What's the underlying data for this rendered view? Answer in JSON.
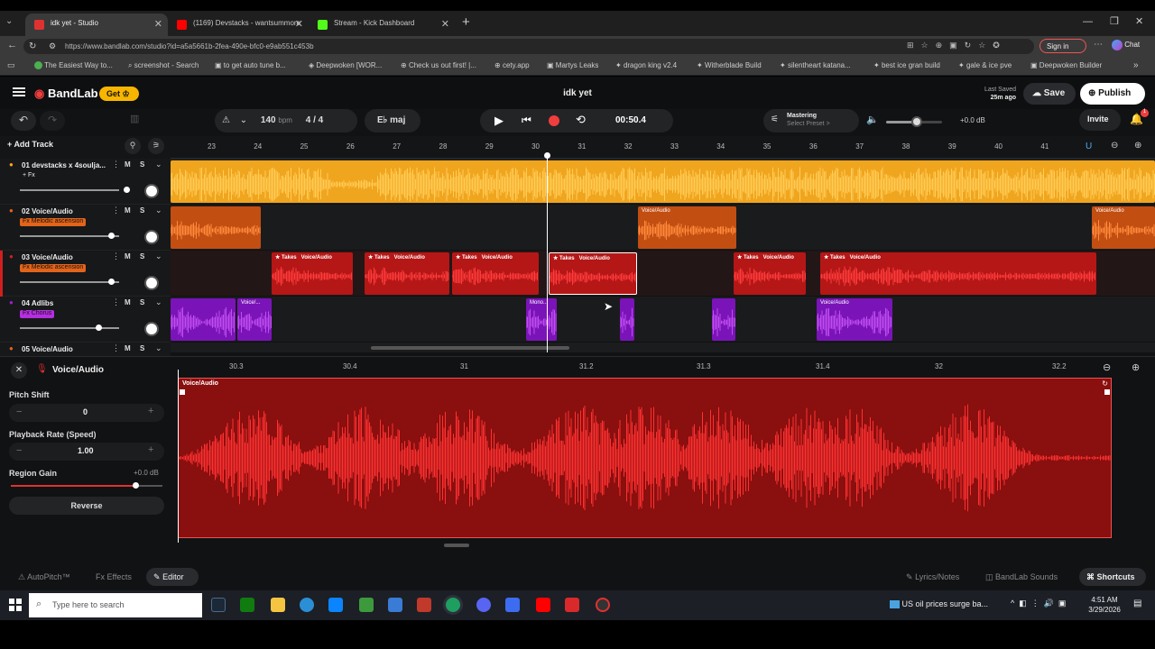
{
  "browser": {
    "tabs": [
      {
        "label": "idk yet - Studio",
        "active": true,
        "color": "#e03131"
      },
      {
        "label": "(1169) Devstacks - wantsummore",
        "active": false,
        "color": "#ff0000"
      },
      {
        "label": "Stream - Kick Dashboard",
        "active": false,
        "color": "#53fc18"
      }
    ],
    "url": "https://www.bandlab.com/studio?id=a5a5661b-2fea-490e-bfc0-e9ab551c453b",
    "sign_in": "Sign in",
    "chat": "Chat",
    "bookmarks": [
      "The Easiest Way to...",
      "screenshot - Search",
      "to get auto tune b...",
      "Deepwoken [WOR...",
      "Check us out first! |...",
      "cety.app",
      "Martys Leaks",
      "dragon king v2.4",
      "Witherblade Build",
      "silentheart katana...",
      "best ice gran build",
      "gale & ice pve",
      "Deepwoken Builder"
    ]
  },
  "app": {
    "brand": "BandLab",
    "get_label": "Get",
    "project_title": "idk yet",
    "last_saved_label": "Last Saved",
    "last_saved_time": "25m ago",
    "save_label": "Save",
    "publish_label": "Publish",
    "invite_label": "Invite",
    "notif_count": "1",
    "bpm": "140",
    "bpm_unit": "bpm",
    "time_signature": "4 / 4",
    "key": "E♭ maj",
    "time_display": "00:50.4",
    "mastering_label": "Mastering",
    "mastering_preset": "Select Preset >",
    "master_volume": "+0.0 dB",
    "master_volume_level": 0.55,
    "add_track_label": "Add Track",
    "accent": "#f7b500"
  },
  "ruler": [
    "23",
    "24",
    "25",
    "26",
    "27",
    "28",
    "29",
    "30",
    "31",
    "32",
    "33",
    "34",
    "35",
    "36",
    "37",
    "38",
    "39",
    "40",
    "41"
  ],
  "tracks": [
    {
      "name": "01  devstacks x 4soulja...",
      "fx": "+ Fx",
      "color": "#f7a81b",
      "volume": 0.82
    },
    {
      "name": "02  Voice/Audio",
      "fx": "Fx  Melodic ascension",
      "color": "#e2641b",
      "volume": 0.7
    },
    {
      "name": "03  Voice/Audio",
      "fx": "Fx  Melodic ascension",
      "color": "#d11f1f",
      "volume": 0.7
    },
    {
      "name": "04  Adlibs",
      "fx": "Fx  Chorus",
      "color": "#9d1fd1",
      "volume": 0.6
    },
    {
      "name": "05  Voice/Audio",
      "fx": "",
      "color": "#e2641b",
      "volume": 0.6
    }
  ],
  "clips": {
    "voice_audio": "Voice/Audio",
    "takes": "Takes",
    "mono": "Mono...",
    "voice_short": "Voice/..."
  },
  "editor": {
    "title": "Voice/Audio",
    "ruler": [
      "30.3",
      "30.4",
      "31",
      "31.2",
      "31.3",
      "31.4",
      "32",
      "32.2"
    ],
    "clip_label": "Voice/Audio",
    "pitch_shift_label": "Pitch Shift",
    "pitch_shift_value": "0",
    "playback_rate_label": "Playback Rate (Speed)",
    "playback_rate_value": "1.00",
    "region_gain_label": "Region Gain",
    "region_gain_value": "+0.0 dB",
    "region_gain_level": 0.82,
    "reverse_label": "Reverse"
  },
  "bottom": {
    "autopitch": "AutoPitch™",
    "effects": "Effects",
    "editor": "Editor",
    "lyrics": "Lyrics/Notes",
    "sounds": "BandLab Sounds",
    "shortcuts": "Shortcuts"
  },
  "taskbar": {
    "search_placeholder": "Type here to search",
    "news": "US oil prices surge ba...",
    "time": "4:51 AM",
    "date": "3/29/2026"
  }
}
